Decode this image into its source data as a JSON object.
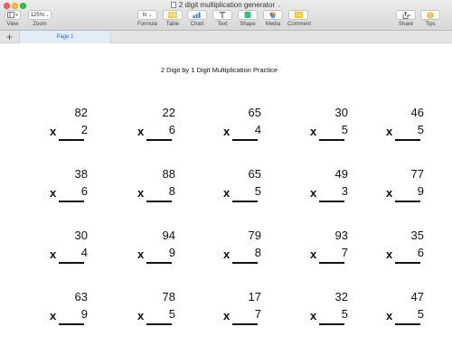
{
  "window": {
    "title": "2 digit multiplication generator"
  },
  "toolbar": {
    "view_label": "View",
    "zoom_value": "125%",
    "zoom_label": "Zoom",
    "formula_label": "Formula",
    "formula_icon": "fx",
    "table_label": "Table",
    "chart_label": "Chart",
    "text_label": "Text",
    "shape_label": "Shape",
    "media_label": "Media",
    "comment_label": "Comment",
    "share_label": "Share",
    "tips_label": "Tips"
  },
  "tabs": {
    "add_symbol": "+",
    "page_label": "Page 1"
  },
  "sheet": {
    "title": "2 Digit by 1 Digit Multiplication Practice",
    "operator": "x",
    "rows": [
      [
        {
          "top": "82",
          "bottom": "2"
        },
        {
          "top": "22",
          "bottom": "6"
        },
        {
          "top": "65",
          "bottom": "4"
        },
        {
          "top": "30",
          "bottom": "5"
        },
        {
          "top": "46",
          "bottom": "5"
        }
      ],
      [
        {
          "top": "38",
          "bottom": "6"
        },
        {
          "top": "88",
          "bottom": "8"
        },
        {
          "top": "65",
          "bottom": "5"
        },
        {
          "top": "49",
          "bottom": "3"
        },
        {
          "top": "77",
          "bottom": "9"
        }
      ],
      [
        {
          "top": "30",
          "bottom": "4"
        },
        {
          "top": "94",
          "bottom": "9"
        },
        {
          "top": "79",
          "bottom": "8"
        },
        {
          "top": "93",
          "bottom": "7"
        },
        {
          "top": "35",
          "bottom": "6"
        }
      ],
      [
        {
          "top": "63",
          "bottom": "9"
        },
        {
          "top": "78",
          "bottom": "5"
        },
        {
          "top": "17",
          "bottom": "7"
        },
        {
          "top": "32",
          "bottom": "5"
        },
        {
          "top": "47",
          "bottom": "5"
        }
      ]
    ]
  }
}
